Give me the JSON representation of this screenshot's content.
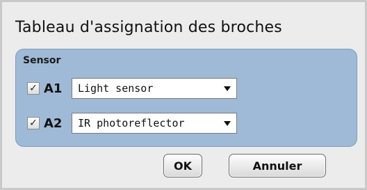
{
  "dialog": {
    "title": "Tableau d'assignation des broches"
  },
  "sensor_group": {
    "title": "Sensor",
    "rows": [
      {
        "pin": "A1",
        "checked": true,
        "check_glyph": "✓",
        "selected": "Light sensor"
      },
      {
        "pin": "A2",
        "checked": true,
        "check_glyph": "✓",
        "selected": "IR photoreflector"
      }
    ]
  },
  "buttons": {
    "ok_label": "OK",
    "cancel_label": "Annuler"
  },
  "colors": {
    "dialog_bg": "#ececec",
    "group_bg": "#9fbad6"
  }
}
